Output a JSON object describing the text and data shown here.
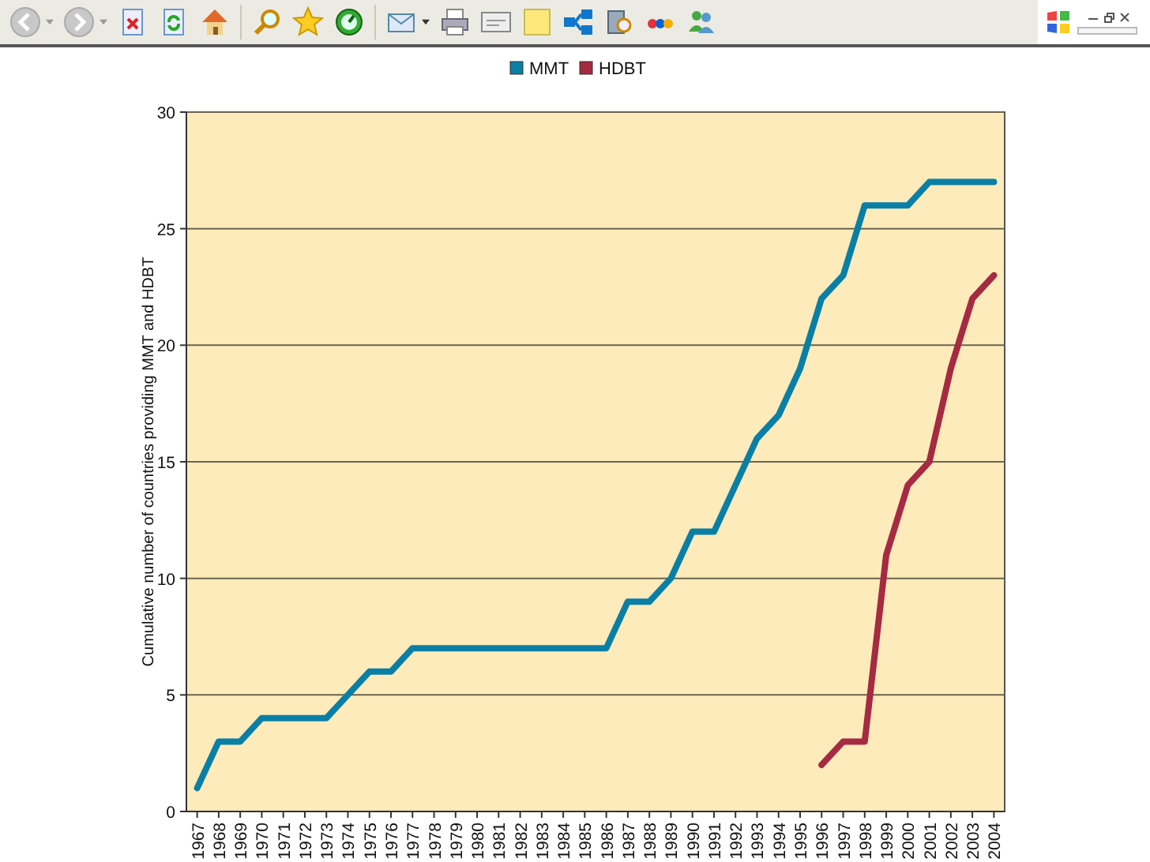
{
  "chart_data": {
    "type": "line",
    "grid": true,
    "legend": true,
    "ylabel": "Cumulative number of countries providing MMT and HDBT",
    "categories": [
      "1967",
      "1968",
      "1969",
      "1970",
      "1971",
      "1972",
      "1973",
      "1974",
      "1975",
      "1976",
      "1977",
      "1978",
      "1979",
      "1980",
      "1981",
      "1982",
      "1983",
      "1984",
      "1985",
      "1986",
      "1987",
      "1988",
      "1989",
      "1990",
      "1991",
      "1992",
      "1993",
      "1994",
      "1995",
      "1996",
      "1997",
      "1998",
      "1999",
      "2000",
      "2001",
      "2002",
      "2003",
      "2004"
    ],
    "ylim": [
      0,
      30
    ],
    "yticks": [
      0,
      5,
      10,
      15,
      20,
      25,
      30
    ],
    "series": [
      {
        "name": "MMT",
        "color": "#0a7fa6",
        "values": [
          1,
          3,
          3,
          4,
          4,
          4,
          4,
          5,
          6,
          6,
          7,
          7,
          7,
          7,
          7,
          7,
          7,
          7,
          7,
          7,
          9,
          9,
          10,
          12,
          12,
          14,
          16,
          17,
          19,
          22,
          23,
          26,
          26,
          26,
          27,
          27,
          27,
          27
        ]
      },
      {
        "name": "HDBT",
        "color": "#a52a42",
        "values": [
          null,
          null,
          null,
          null,
          null,
          null,
          null,
          null,
          null,
          null,
          null,
          null,
          null,
          null,
          null,
          null,
          null,
          null,
          null,
          null,
          null,
          null,
          null,
          null,
          null,
          null,
          null,
          null,
          null,
          2,
          3,
          3,
          11,
          14,
          15,
          19,
          22,
          23
        ]
      }
    ]
  }
}
